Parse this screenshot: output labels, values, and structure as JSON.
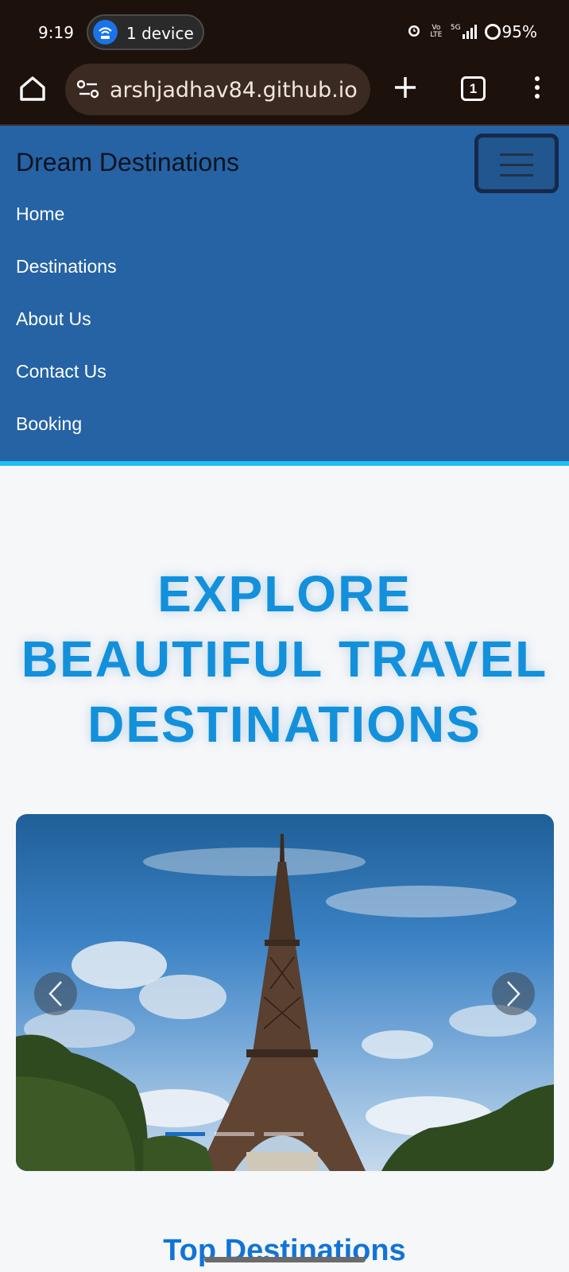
{
  "status_bar": {
    "time": "9:19",
    "device_pill": "1 device",
    "network_small": "Vo LTE",
    "network_5g": "5G",
    "battery": "95%"
  },
  "browser": {
    "url": "arshjadhav84.github.io",
    "tab_count": "1"
  },
  "navbar": {
    "brand": "Dream Destinations",
    "items": [
      {
        "label": "Home"
      },
      {
        "label": "Destinations"
      },
      {
        "label": "About Us"
      },
      {
        "label": "Contact Us"
      },
      {
        "label": "Booking"
      }
    ]
  },
  "hero": {
    "lines": [
      "EXPLORE",
      "BEAUTIFUL TRAVEL",
      "DESTINATIONS"
    ]
  },
  "carousel": {
    "image_subject": "eiffel-tower",
    "slide_count": 3,
    "active_slide": 1
  },
  "section_title": "Top Destinations",
  "colors": {
    "navbar_bg": "#2563a4",
    "navbar_border": "#22c0f1",
    "hero_text": "#1290dc",
    "page_bg": "#f6f7f9"
  }
}
